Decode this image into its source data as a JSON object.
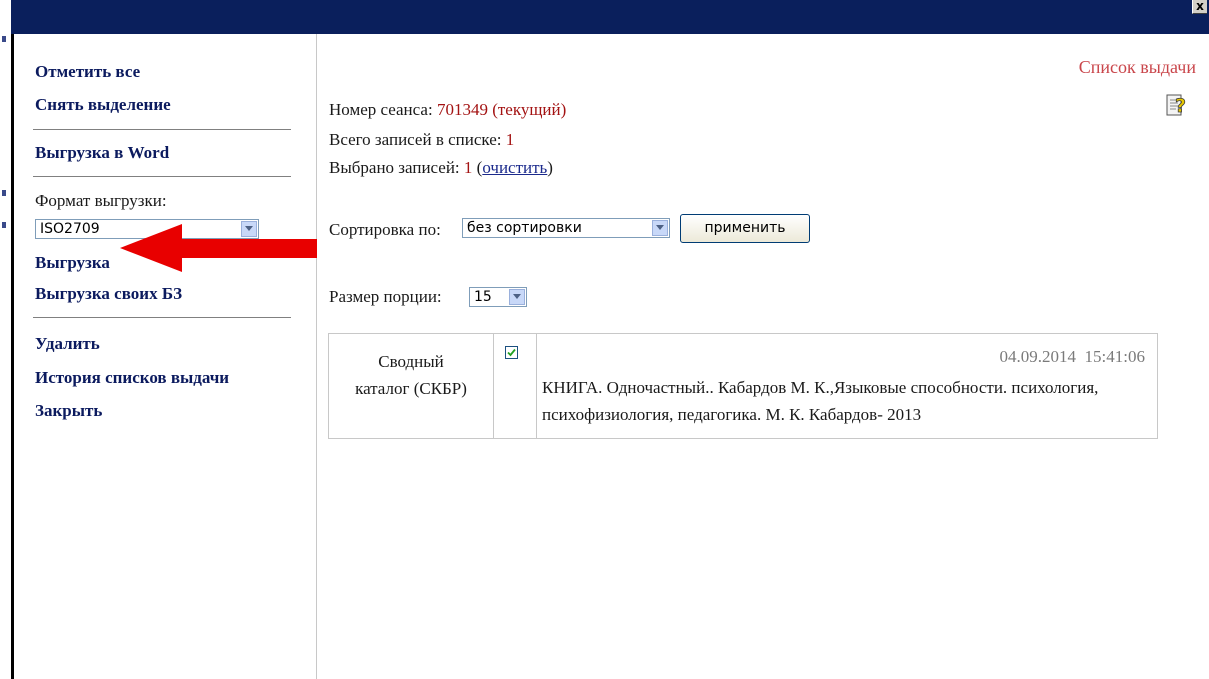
{
  "window": {
    "close_label": "x"
  },
  "sidebar": {
    "select_all": "Отметить все",
    "deselect": "Снять выделение",
    "export_word": "Выгрузка в Word",
    "format_label": "Формат выгрузки:",
    "format_value": "ISO2709",
    "export": "Выгрузка",
    "export_own": "Выгрузка своих БЗ",
    "delete": "Удалить",
    "history": "История списков выдачи",
    "close": "Закрыть"
  },
  "main": {
    "title": "Список выдачи",
    "session_label": "Номер сеанса:",
    "session_value": "701349 (текущий)",
    "total_label": "Всего записей в списке:",
    "total_value": "1",
    "selected_label": "Выбрано записей:",
    "selected_value": "1",
    "clear_link": "очистить",
    "sort_label": "Сортировка по:",
    "sort_value": "без сортировки",
    "apply_button": "применить",
    "portion_label": "Размер порции:",
    "portion_value": "15"
  },
  "records": [
    {
      "catalog_line1": "Сводный",
      "catalog_line2": "каталог (СКБР)",
      "checked": true,
      "date": "04.09.2014",
      "time": "15:41:06",
      "text": "КНИГА. Одночастный.. Кабардов М. К.,Языковые способности. психология, психофизиология, педагогика. М. К. Кабардов- 2013"
    }
  ],
  "colors": {
    "titlebar": "#0a1f5c",
    "link": "#0b1a5e",
    "accent_red": "#a31212",
    "title_red": "#c9454a",
    "annotation_arrow": "#e80000"
  },
  "icons": {
    "help": "help-icon",
    "close": "close-icon",
    "checkbox": "checkmark-icon",
    "dropdown": "chevron-down-icon",
    "annotation": "red-arrow-icon"
  }
}
